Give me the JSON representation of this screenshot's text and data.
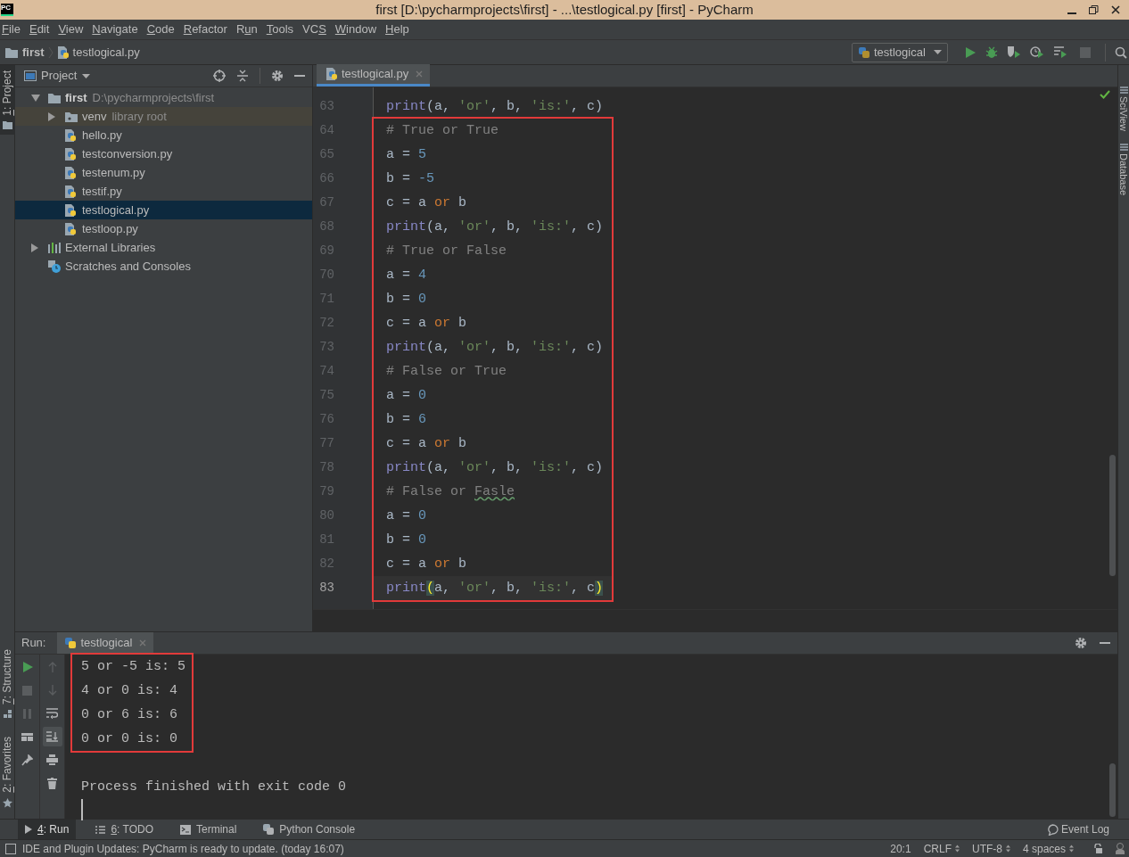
{
  "window": {
    "app_logo": "PC",
    "title": "first [D:\\pycharmprojects\\first] - ...\\testlogical.py [first] - PyCharm"
  },
  "menu": [
    {
      "key": "F",
      "post": "ile"
    },
    {
      "key": "E",
      "post": "dit"
    },
    {
      "key": "V",
      "post": "iew"
    },
    {
      "key": "N",
      "post": "avigate"
    },
    {
      "key": "C",
      "post": "ode"
    },
    {
      "key": "R",
      "post": "efactor"
    },
    {
      "pre": "R",
      "key": "u",
      "post": "n"
    },
    {
      "key": "T",
      "post": "ools"
    },
    {
      "pre": "VC",
      "key": "S"
    },
    {
      "key": "W",
      "post": "indow"
    },
    {
      "key": "H",
      "post": "elp"
    }
  ],
  "breadcrumbs": [
    {
      "kind": "folder",
      "label": "first"
    },
    {
      "kind": "python",
      "label": "testlogical.py"
    }
  ],
  "run_config": {
    "label": "testlogical"
  },
  "left_stripe": [
    {
      "key": "1",
      "post": ": Project",
      "kind": "project",
      "selected": true
    },
    {
      "key": "7",
      "post": ": Structure",
      "kind": "structure",
      "selected": false
    },
    {
      "key": "2",
      "post": ": Favorites",
      "kind": "favorites",
      "selected": false
    }
  ],
  "right_stripe": [
    {
      "label": "SciView"
    },
    {
      "label": "Database"
    }
  ],
  "project_panel": {
    "title": "Project",
    "tree": [
      {
        "kind": "folder",
        "label": "first",
        "detail": "D:\\pycharmprojects\\first",
        "expanded": true,
        "selected": false,
        "children": [
          {
            "kind": "library",
            "label": "venv",
            "detail": "library root",
            "expanded": false,
            "selected": false
          },
          {
            "kind": "python",
            "label": "hello.py",
            "selected": false
          },
          {
            "kind": "python",
            "label": "testconversion.py",
            "selected": false
          },
          {
            "kind": "python",
            "label": "testenum.py",
            "selected": false
          },
          {
            "kind": "python",
            "label": "testif.py",
            "selected": false
          },
          {
            "kind": "python",
            "label": "testlogical.py",
            "selected": true
          },
          {
            "kind": "python",
            "label": "testloop.py",
            "selected": false
          }
        ]
      },
      {
        "kind": "libraries",
        "label": "External Libraries",
        "expanded": false,
        "selected": false
      },
      {
        "kind": "scratches",
        "label": "Scratches and Consoles",
        "selected": false
      }
    ]
  },
  "editor": {
    "tabs": [
      {
        "label": "testlogical.py",
        "selected": true
      }
    ],
    "lines": [
      {
        "number": "63",
        "annotated": false,
        "current": false,
        "tokens": [
          {
            "kind": "fn",
            "text": "print"
          },
          {
            "kind": "plain",
            "text": "(a, "
          },
          {
            "kind": "str",
            "text": "'or'"
          },
          {
            "kind": "plain",
            "text": ", b, "
          },
          {
            "kind": "str",
            "text": "'is:'"
          },
          {
            "kind": "plain",
            "text": ", c)"
          }
        ]
      },
      {
        "number": "64",
        "annotated": true,
        "current": false,
        "tokens": [
          {
            "kind": "comment",
            "text": "# True or True"
          }
        ]
      },
      {
        "number": "65",
        "annotated": true,
        "current": false,
        "tokens": [
          {
            "kind": "plain",
            "text": "a = "
          },
          {
            "kind": "num",
            "text": "5"
          }
        ]
      },
      {
        "number": "66",
        "annotated": true,
        "current": false,
        "tokens": [
          {
            "kind": "plain",
            "text": "b = "
          },
          {
            "kind": "num",
            "text": "-5"
          }
        ]
      },
      {
        "number": "67",
        "annotated": true,
        "current": false,
        "tokens": [
          {
            "kind": "plain",
            "text": "c = a "
          },
          {
            "kind": "kw",
            "text": "or"
          },
          {
            "kind": "plain",
            "text": " b"
          }
        ]
      },
      {
        "number": "68",
        "annotated": true,
        "current": false,
        "tokens": [
          {
            "kind": "fn",
            "text": "print"
          },
          {
            "kind": "plain",
            "text": "(a, "
          },
          {
            "kind": "str",
            "text": "'or'"
          },
          {
            "kind": "plain",
            "text": ", b, "
          },
          {
            "kind": "str",
            "text": "'is:'"
          },
          {
            "kind": "plain",
            "text": ", c)"
          }
        ]
      },
      {
        "number": "69",
        "annotated": true,
        "current": false,
        "tokens": [
          {
            "kind": "comment",
            "text": "# True or False"
          }
        ]
      },
      {
        "number": "70",
        "annotated": true,
        "current": false,
        "tokens": [
          {
            "kind": "plain",
            "text": "a = "
          },
          {
            "kind": "num",
            "text": "4"
          }
        ]
      },
      {
        "number": "71",
        "annotated": true,
        "current": false,
        "tokens": [
          {
            "kind": "plain",
            "text": "b = "
          },
          {
            "kind": "num",
            "text": "0"
          }
        ]
      },
      {
        "number": "72",
        "annotated": true,
        "current": false,
        "tokens": [
          {
            "kind": "plain",
            "text": "c = a "
          },
          {
            "kind": "kw",
            "text": "or"
          },
          {
            "kind": "plain",
            "text": " b"
          }
        ]
      },
      {
        "number": "73",
        "annotated": true,
        "current": false,
        "tokens": [
          {
            "kind": "fn",
            "text": "print"
          },
          {
            "kind": "plain",
            "text": "(a, "
          },
          {
            "kind": "str",
            "text": "'or'"
          },
          {
            "kind": "plain",
            "text": ", b, "
          },
          {
            "kind": "str",
            "text": "'is:'"
          },
          {
            "kind": "plain",
            "text": ", c)"
          }
        ]
      },
      {
        "number": "74",
        "annotated": true,
        "current": false,
        "tokens": [
          {
            "kind": "comment",
            "text": "# False or True"
          }
        ]
      },
      {
        "number": "75",
        "annotated": true,
        "current": false,
        "tokens": [
          {
            "kind": "plain",
            "text": "a = "
          },
          {
            "kind": "num",
            "text": "0"
          }
        ]
      },
      {
        "number": "76",
        "annotated": true,
        "current": false,
        "tokens": [
          {
            "kind": "plain",
            "text": "b = "
          },
          {
            "kind": "num",
            "text": "6"
          }
        ]
      },
      {
        "number": "77",
        "annotated": true,
        "current": false,
        "tokens": [
          {
            "kind": "plain",
            "text": "c = a "
          },
          {
            "kind": "kw",
            "text": "or"
          },
          {
            "kind": "plain",
            "text": " b"
          }
        ]
      },
      {
        "number": "78",
        "annotated": true,
        "current": false,
        "tokens": [
          {
            "kind": "fn",
            "text": "print"
          },
          {
            "kind": "plain",
            "text": "(a, "
          },
          {
            "kind": "str",
            "text": "'or'"
          },
          {
            "kind": "plain",
            "text": ", b, "
          },
          {
            "kind": "str",
            "text": "'is:'"
          },
          {
            "kind": "plain",
            "text": ", c)"
          }
        ]
      },
      {
        "number": "79",
        "annotated": true,
        "current": false,
        "tokens": [
          {
            "kind": "comment",
            "text": "# False or "
          },
          {
            "kind": "typo",
            "text": "Fasle"
          }
        ]
      },
      {
        "number": "80",
        "annotated": true,
        "current": false,
        "tokens": [
          {
            "kind": "plain",
            "text": "a = "
          },
          {
            "kind": "num",
            "text": "0"
          }
        ]
      },
      {
        "number": "81",
        "annotated": true,
        "current": false,
        "tokens": [
          {
            "kind": "plain",
            "text": "b = "
          },
          {
            "kind": "num",
            "text": "0"
          }
        ]
      },
      {
        "number": "82",
        "annotated": true,
        "current": false,
        "tokens": [
          {
            "kind": "plain",
            "text": "c = a "
          },
          {
            "kind": "kw",
            "text": "or"
          },
          {
            "kind": "plain",
            "text": " b"
          }
        ]
      },
      {
        "number": "83",
        "annotated": true,
        "current": true,
        "tokens": [
          {
            "kind": "fn",
            "text": "print"
          },
          {
            "kind": "brace",
            "text": "("
          },
          {
            "kind": "plain",
            "text": "a, "
          },
          {
            "kind": "str",
            "text": "'or'"
          },
          {
            "kind": "plain",
            "text": ", b, "
          },
          {
            "kind": "str",
            "text": "'is:'"
          },
          {
            "kind": "plain",
            "text": ", c"
          },
          {
            "kind": "brace",
            "text": ")"
          }
        ]
      }
    ]
  },
  "run_panel": {
    "label": "Run:",
    "tabs": [
      {
        "label": "testlogical",
        "selected": true
      }
    ],
    "actions": [
      {
        "kind": "rerun",
        "disabled": false
      },
      {
        "kind": "stop",
        "disabled": true
      },
      {
        "kind": "pause",
        "disabled": true
      },
      {
        "kind": "layout",
        "disabled": false
      },
      {
        "kind": "pin",
        "disabled": false
      }
    ],
    "tools": [
      {
        "kind": "up",
        "disabled": true,
        "on": false
      },
      {
        "kind": "down",
        "disabled": true,
        "on": false
      },
      {
        "kind": "wrap",
        "disabled": false,
        "on": false
      },
      {
        "kind": "scroll-end",
        "disabled": false,
        "on": true
      },
      {
        "kind": "print",
        "disabled": false,
        "on": false
      },
      {
        "kind": "trash",
        "disabled": false,
        "on": false
      }
    ],
    "output": [
      {
        "text": "5 or -5 is: 5",
        "annotated": true
      },
      {
        "text": "4 or 0 is: 4",
        "annotated": true
      },
      {
        "text": "0 or 6 is: 6",
        "annotated": true
      },
      {
        "text": "0 or 0 is: 0",
        "annotated": true
      }
    ],
    "exit_message": "Process finished with exit code 0"
  },
  "tool_tabs": [
    {
      "kind": "run",
      "key": "4",
      "post": ": Run",
      "selected": true
    },
    {
      "kind": "todo",
      "key": "6",
      "post": ": TODO",
      "selected": false
    },
    {
      "kind": "terminal",
      "label": "Terminal",
      "selected": false
    },
    {
      "kind": "console",
      "label": "Python Console",
      "selected": false
    }
  ],
  "event_log": "Event Log",
  "status": {
    "message": "IDE and Plugin Updates: PyCharm is ready to update. (today 16:07)",
    "position": "20:1",
    "line_separator": "CRLF",
    "encoding": "UTF-8",
    "indent": "4 spaces"
  }
}
